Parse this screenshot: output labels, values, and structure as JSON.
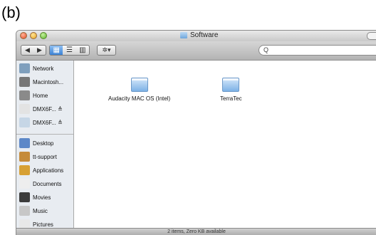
{
  "panel_label": "(b)",
  "window": {
    "title": "Software"
  },
  "toolbar": {
    "back_glyph": "◀",
    "forward_glyph": "▶",
    "view_icons": [
      "▦",
      "☰",
      "▥"
    ],
    "action_glyph": "✲▾",
    "search_glyph": "Q"
  },
  "sidebar": {
    "devices": [
      {
        "label": "Network",
        "icon": "network-icon",
        "color": "#7f9fbd"
      },
      {
        "label": "Macintosh...",
        "icon": "hard-drive-icon",
        "color": "#777777"
      },
      {
        "label": "Home",
        "icon": "home-drive-icon",
        "color": "#8a8a8a"
      },
      {
        "label": "DMX6F... ≜",
        "icon": "disk-icon",
        "color": "#e3e3e3"
      },
      {
        "label": "DMX6F... ≜",
        "icon": "cd-icon",
        "color": "#c6d6e6"
      }
    ],
    "places": [
      {
        "label": "Desktop",
        "icon": "desktop-icon",
        "color": "#5d88c8"
      },
      {
        "label": "tt-support",
        "icon": "home-icon",
        "color": "#c58b3a"
      },
      {
        "label": "Applications",
        "icon": "applications-icon",
        "color": "#d7a033"
      },
      {
        "label": "Documents",
        "icon": "documents-icon",
        "color": "#eeeeee"
      },
      {
        "label": "Movies",
        "icon": "movies-icon",
        "color": "#3b3b3b"
      },
      {
        "label": "Music",
        "icon": "music-icon",
        "color": "#c7c7c7"
      },
      {
        "label": "Pictures",
        "icon": "pictures-icon",
        "color": "#e8e8e8"
      }
    ]
  },
  "files": [
    {
      "label": "Audacity MAC OS (Intel)",
      "icon": "folder-icon"
    },
    {
      "label": "TerraTec",
      "icon": "folder-icon"
    }
  ],
  "status": {
    "text": "2 items, Zero KB available"
  }
}
